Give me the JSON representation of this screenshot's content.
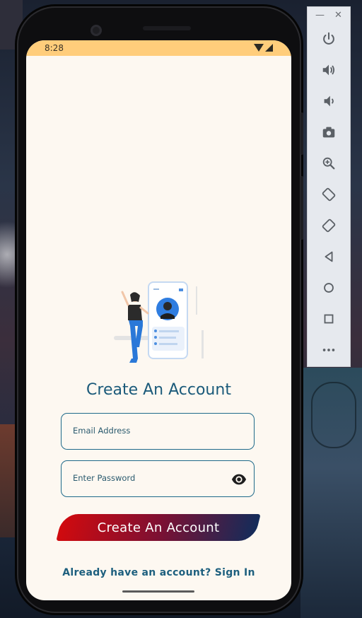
{
  "status_bar": {
    "time": "8:28"
  },
  "screen": {
    "title": "Create An Account",
    "email_field": {
      "placeholder": "Email Address"
    },
    "password_field": {
      "placeholder": "Enter Password"
    },
    "cta_label": "Create An Account",
    "signin_link": "Already have an account? Sign In"
  },
  "emulator": {
    "icons": [
      "power-icon",
      "volume-up-icon",
      "volume-down-icon",
      "screenshot-icon",
      "zoom-icon",
      "rotate-left-icon",
      "rotate-right-icon",
      "back-icon",
      "home-icon",
      "overview-icon",
      "more-icon"
    ]
  },
  "colors": {
    "status_bar": "#ffcd7b",
    "screen_bg": "#fdf8f1",
    "accent": "#1b5a7a",
    "cta_start": "#d10a0e",
    "cta_end": "#132c5a"
  }
}
